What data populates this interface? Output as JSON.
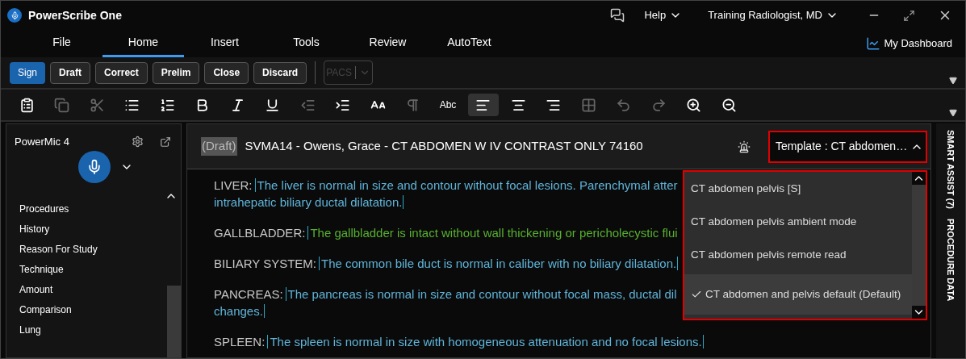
{
  "window": {
    "title": "PowerScribe One",
    "help": "Help",
    "user": "Training Radiologist, MD"
  },
  "menu_tabs": [
    {
      "label": "File",
      "selected": false
    },
    {
      "label": "Home",
      "selected": true
    },
    {
      "label": "Insert",
      "selected": false
    },
    {
      "label": "Tools",
      "selected": false
    },
    {
      "label": "Review",
      "selected": false
    },
    {
      "label": "AutoText",
      "selected": false
    }
  ],
  "dashboard_link": "My Dashboard",
  "actions": [
    {
      "label": "Sign",
      "kind": "primary"
    },
    {
      "label": "Draft",
      "kind": "normal"
    },
    {
      "label": "Correct",
      "kind": "normal"
    },
    {
      "label": "Prelim",
      "kind": "normal"
    },
    {
      "label": "Close",
      "kind": "normal"
    },
    {
      "label": "Discard",
      "kind": "normal"
    }
  ],
  "pacs": {
    "label": "PACS",
    "disabled": true
  },
  "toolbar": [
    {
      "kind": "icon",
      "disabled": false,
      "selected": false
    },
    {
      "kind": "icon",
      "disabled": true,
      "selected": false
    },
    {
      "kind": "icon",
      "disabled": true,
      "selected": false
    },
    {
      "kind": "icon",
      "disabled": false,
      "selected": false
    },
    {
      "kind": "icon",
      "disabled": false,
      "selected": false
    },
    {
      "kind": "icon",
      "disabled": false,
      "selected": false
    },
    {
      "kind": "icon",
      "disabled": false,
      "selected": false
    },
    {
      "kind": "icon",
      "disabled": false,
      "selected": false
    },
    {
      "kind": "icon",
      "disabled": true,
      "selected": false
    },
    {
      "kind": "icon",
      "disabled": false,
      "selected": false
    },
    {
      "kind": "icon",
      "disabled": false,
      "selected": false
    },
    {
      "kind": "icon",
      "disabled": true,
      "selected": false
    },
    {
      "kind": "text",
      "label": "Abc",
      "disabled": false,
      "selected": false
    },
    {
      "kind": "icon",
      "disabled": false,
      "selected": true
    },
    {
      "kind": "icon",
      "disabled": false,
      "selected": false
    },
    {
      "kind": "icon",
      "disabled": false,
      "selected": false
    },
    {
      "kind": "icon",
      "disabled": true,
      "selected": false
    },
    {
      "kind": "icon",
      "disabled": true,
      "selected": false
    },
    {
      "kind": "icon",
      "disabled": true,
      "selected": false
    },
    {
      "kind": "icon",
      "disabled": false,
      "selected": false
    },
    {
      "kind": "icon",
      "disabled": false,
      "selected": false
    }
  ],
  "sidebar": {
    "title": "PowerMic 4",
    "items": [
      "Procedures",
      "History",
      "Reason For Study",
      "Technique",
      "Amount",
      "Comparison",
      "Lung"
    ]
  },
  "editor": {
    "status": "(Draft)",
    "title": "SVMA14 - Owens, Grace - CT ABDOMEN W IV CONTRAST ONLY 74160",
    "template": "Template : CT abdomen…",
    "findings": [
      {
        "label": "LIVER:",
        "lines": [
          "The liver is normal in size and contour without focal lesions. Parenchymal atter",
          "intrahepatic biliary ductal dilatation."
        ],
        "closed": true,
        "color": "#5fb4d9"
      },
      {
        "label": "GALLBLADDER:",
        "lines": [
          "The gallbladder is intact without wall thickening or pericholecystic flui"
        ],
        "closed": false,
        "color": "#58b030"
      },
      {
        "label": "BILIARY SYSTEM:",
        "lines": [
          "The common bile duct is normal in caliber with no biliary dilatation."
        ],
        "closed": true,
        "color": "#5fb4d9"
      },
      {
        "label": "PANCREAS:",
        "lines": [
          "The pancreas is normal in size and contour without focal mass, ductal dil",
          "changes."
        ],
        "closed": true,
        "color": "#5fb4d9"
      },
      {
        "label": "SPLEEN:",
        "lines": [
          "The spleen is normal in size with homogeneous attenuation and no focal lesions."
        ],
        "closed": true,
        "color": "#5fb4d9"
      }
    ],
    "template_options": [
      {
        "label": "CT abdomen pelvis [S]",
        "selected": false
      },
      {
        "label": "CT abdomen pelvis ambient mode",
        "selected": false
      },
      {
        "label": "CT abdomen pelvis remote read",
        "selected": false
      },
      {
        "label": "CT abdomen and pelvis default (Default)",
        "selected": true
      }
    ]
  },
  "side_tabs": [
    "SMART ASSIST (7)",
    "PROCEDURE DATA"
  ]
}
